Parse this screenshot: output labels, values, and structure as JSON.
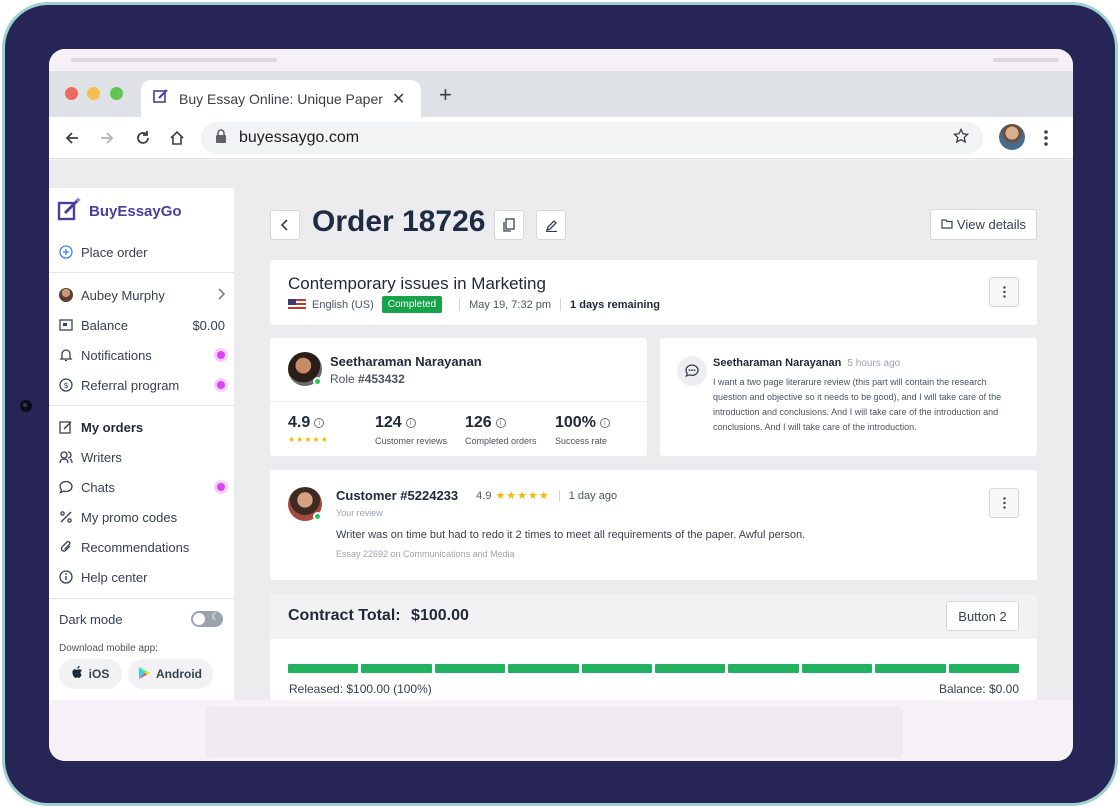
{
  "browser": {
    "tab_title": "Buy Essay Online: Unique Paper",
    "tab_close": "✕",
    "new_tab": "+",
    "url": "buyessaygo.com"
  },
  "sidebar": {
    "logo_prefix": "Buy",
    "logo_suffix": "EssayGo",
    "place_order": "Place order",
    "user_name": "Aubey Murphy",
    "balance_label": "Balance",
    "balance_value": "$0.00",
    "notifications": "Notifications",
    "referral": "Referral program",
    "items": [
      {
        "label": "My orders"
      },
      {
        "label": "Writers"
      },
      {
        "label": "Chats"
      },
      {
        "label": "My promo codes"
      },
      {
        "label": "Recommendations"
      },
      {
        "label": "Help center"
      }
    ],
    "dark_mode": "Dark mode",
    "dark_mode_on": false,
    "download_label": "Download mobile app:",
    "ios": "iOS",
    "android": "Android"
  },
  "order": {
    "title": "Order 18726",
    "view_details": "View details",
    "subject": "Contemporary issues in Marketing",
    "language": "English (US)",
    "status": "Completed",
    "date": "May 19, 7:32 pm",
    "remaining": "1 days remaining"
  },
  "writer": {
    "name": "Seetharaman Narayanan",
    "role_prefix": "Role",
    "role_id": "#453432",
    "stats": [
      {
        "value": "4.9",
        "label": "★★★★★",
        "stars": true
      },
      {
        "value": "124",
        "label": "Customer reviews"
      },
      {
        "value": "126",
        "label": "Completed orders"
      },
      {
        "value": "100%",
        "label": "Success rate"
      }
    ]
  },
  "message": {
    "author": "Seetharaman Narayanan",
    "time": "5 hours ago",
    "text": "I want a two page literarure review (this part will contain the research question and objective so it needs to be good), and I will take care of the introduction and conclusions. And I will take care of the introduction and conclusions. And I will take care of the introduction."
  },
  "review": {
    "customer": "Customer #5224233",
    "rating": "4.9",
    "stars": "★★★★★",
    "time": "1 day ago",
    "your_review": "Your review",
    "text": "Writer was on time but had to redo it 2 times to meet all requirements of the paper. Awful person.",
    "meta": "Essay 22692 on Communications and Media"
  },
  "contract": {
    "title": "Contract Total:",
    "total": "$100.00",
    "button": "Button 2",
    "released": "Released: $100.00 (100%)",
    "balance": "Balance: $0.00",
    "released_fraction": 1.0
  },
  "colors": {
    "brand": "#4b3f9e",
    "success": "#16a34a",
    "progress": "#22b15e",
    "unread": "#d946ef",
    "star": "#f5b800"
  }
}
